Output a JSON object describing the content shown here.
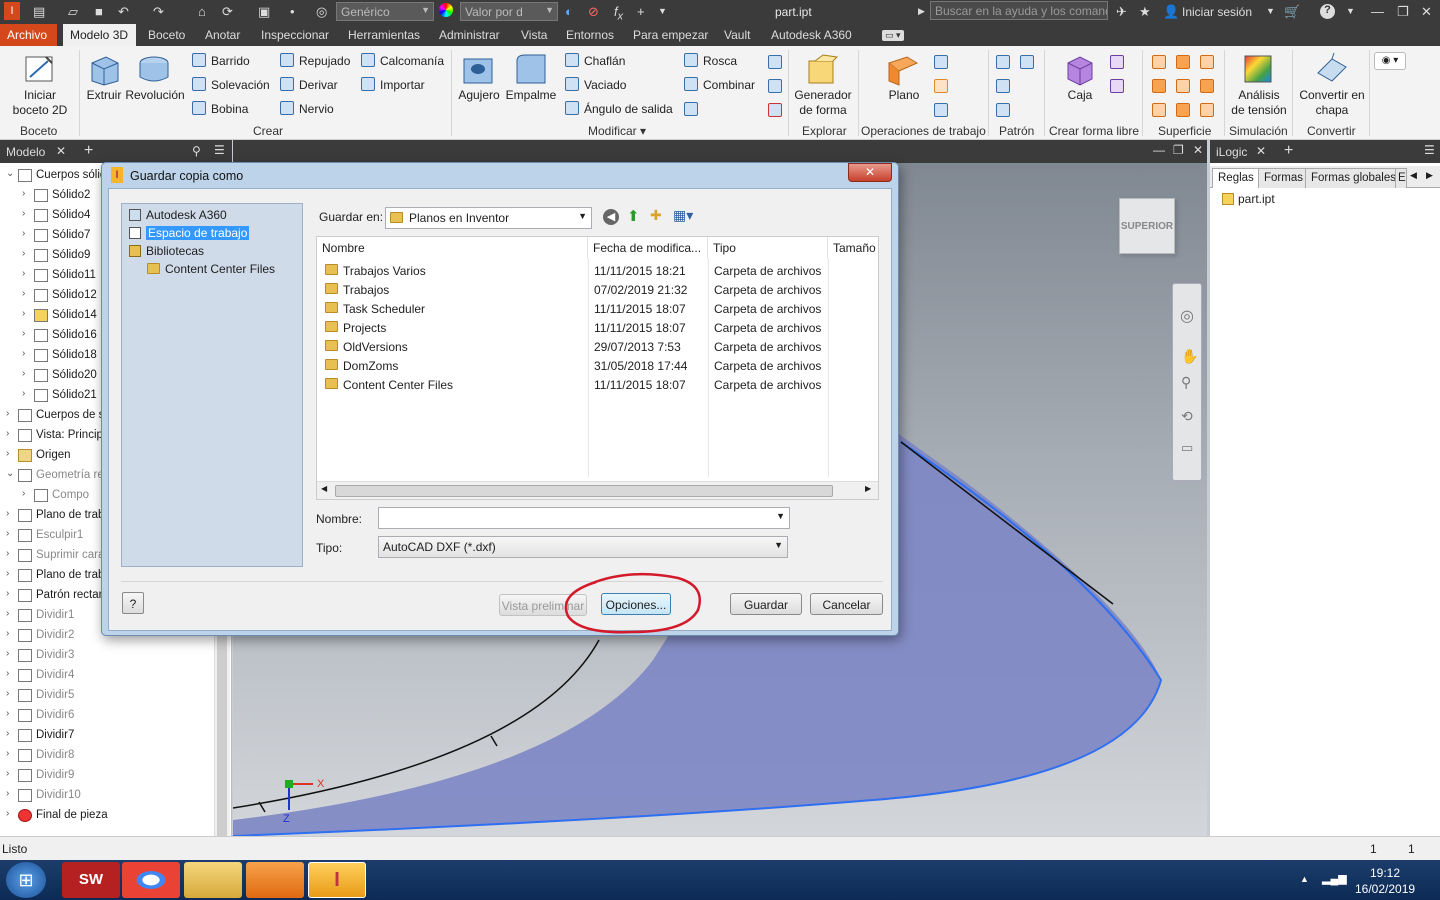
{
  "app": {
    "quick_access": {
      "material_combo": "Genérico",
      "appearance_combo": "Valor por d",
      "file_name": "part.ipt",
      "search_placeholder": "Buscar en la ayuda y los comandos",
      "signin": "Iniciar sesión"
    },
    "ribbon_tabs": [
      "Archivo",
      "Modelo 3D",
      "Boceto",
      "Anotar",
      "Inspeccionar",
      "Herramientas",
      "Administrar",
      "Vista",
      "Entornos",
      "Para empezar",
      "Vault",
      "Autodesk A360"
    ],
    "ribbon": {
      "boceto": {
        "start_sketch": "Iniciar\nboceto 2D",
        "group": "Boceto"
      },
      "crear": {
        "extruir": "Extruir",
        "revolucion": "Revolución",
        "barrido": "Barrido",
        "solevacion": "Solevación",
        "bobina": "Bobina",
        "repujado": "Repujado",
        "derivar": "Derivar",
        "nervio": "Nervio",
        "calcomania": "Calcomanía",
        "importar": "Importar",
        "group": "Crear"
      },
      "modificar": {
        "agujero": "Agujero",
        "empalme": "Empalme",
        "chaflan": "Chaflán",
        "vaciado": "Vaciado",
        "angulo": "Ángulo de salida",
        "rosca": "Rosca",
        "combinar": "Combinar",
        "group": "Modificar ▾"
      },
      "explorar": {
        "generador": "Generador\nde forma",
        "group": "Explorar"
      },
      "operaciones": {
        "plano": "Plano",
        "group": "Operaciones de trabajo"
      },
      "patron": {
        "group": "Patrón"
      },
      "forma_libre": {
        "caja": "Caja",
        "group": "Crear forma libre"
      },
      "superficie": {
        "group": "Superficie"
      },
      "simulacion": {
        "analisis": "Análisis\nde tensión",
        "group": "Simulación"
      },
      "convertir": {
        "chapa": "Convertir en\nchapa",
        "group": "Convertir"
      }
    },
    "browser": {
      "tab": "Modelo",
      "items": [
        {
          "label": "Cuerpos sólidos",
          "lvl": 0
        },
        {
          "label": "Sólido2",
          "lvl": 1
        },
        {
          "label": "Sólido4",
          "lvl": 1
        },
        {
          "label": "Sólido7",
          "lvl": 1
        },
        {
          "label": "Sólido9",
          "lvl": 1
        },
        {
          "label": "Sólido11",
          "lvl": 1
        },
        {
          "label": "Sólido12",
          "lvl": 1
        },
        {
          "label": "Sólido14",
          "lvl": 1
        },
        {
          "label": "Sólido16",
          "lvl": 1
        },
        {
          "label": "Sólido18",
          "lvl": 1
        },
        {
          "label": "Sólido20",
          "lvl": 1
        },
        {
          "label": "Sólido21",
          "lvl": 1
        },
        {
          "label": "Cuerpos de superficie",
          "lvl": 0
        },
        {
          "label": "Vista: Principal",
          "lvl": 0
        },
        {
          "label": "Origen",
          "lvl": 0
        },
        {
          "label": "Geometría re",
          "lvl": 0,
          "dim": true
        },
        {
          "label": "Compo",
          "lvl": 1,
          "dim": true
        },
        {
          "label": "Plano de trabajo",
          "lvl": 0
        },
        {
          "label": "Esculpir1",
          "lvl": 0,
          "dim": true
        },
        {
          "label": "Suprimir cara",
          "lvl": 0,
          "dim": true
        },
        {
          "label": "Plano de trabajo",
          "lvl": 0
        },
        {
          "label": "Patrón rectangular",
          "lvl": 0
        },
        {
          "label": "Dividir1",
          "lvl": 0,
          "dim": true
        },
        {
          "label": "Dividir2",
          "lvl": 0,
          "dim": true
        },
        {
          "label": "Dividir3",
          "lvl": 0,
          "dim": true
        },
        {
          "label": "Dividir4",
          "lvl": 0,
          "dim": true
        },
        {
          "label": "Dividir5",
          "lvl": 0,
          "dim": true
        },
        {
          "label": "Dividir6",
          "lvl": 0,
          "dim": true
        },
        {
          "label": "Dividir7",
          "lvl": 0
        },
        {
          "label": "Dividir8",
          "lvl": 0,
          "dim": true
        },
        {
          "label": "Dividir9",
          "lvl": 0,
          "dim": true
        },
        {
          "label": "Dividir10",
          "lvl": 0,
          "dim": true
        },
        {
          "label": "Final de pieza",
          "lvl": 0
        }
      ]
    },
    "viewcube_label": "SUPERIOR",
    "ilogic": {
      "tab": "iLogic",
      "tabs": [
        "Reglas",
        "Formas",
        "Formas globales",
        "E"
      ],
      "item": "part.ipt"
    },
    "status": {
      "text": "Listo",
      "count1": "1",
      "count2": "1"
    },
    "taskbar": {
      "time": "19:12",
      "date": "16/02/2019"
    }
  },
  "dialog": {
    "title": "Guardar copia como",
    "places": [
      "Autodesk A360",
      "Espacio de trabajo",
      "Bibliotecas",
      "Content Center Files"
    ],
    "save_in_label": "Guardar en:",
    "save_in_value": "Planos en Inventor",
    "columns": [
      "Nombre",
      "Fecha de modifica...",
      "Tipo",
      "Tamaño"
    ],
    "files": [
      {
        "name": "Trabajos Varios",
        "date": "11/11/2015 18:21",
        "type": "Carpeta de archivos"
      },
      {
        "name": "Trabajos",
        "date": "07/02/2019 21:32",
        "type": "Carpeta de archivos"
      },
      {
        "name": "Task Scheduler",
        "date": "11/11/2015 18:07",
        "type": "Carpeta de archivos"
      },
      {
        "name": "Projects",
        "date": "11/11/2015 18:07",
        "type": "Carpeta de archivos"
      },
      {
        "name": "OldVersions",
        "date": "29/07/2013 7:53",
        "type": "Carpeta de archivos"
      },
      {
        "name": "DomZoms",
        "date": "31/05/2018 17:44",
        "type": "Carpeta de archivos"
      },
      {
        "name": "Content Center Files",
        "date": "11/11/2015 18:07",
        "type": "Carpeta de archivos"
      }
    ],
    "name_label": "Nombre:",
    "name_value": "",
    "type_label": "Tipo:",
    "type_value": "AutoCAD DXF (*.dxf)",
    "buttons": {
      "help": "?",
      "preview": "Vista preliminar",
      "options": "Opciones...",
      "save": "Guardar",
      "cancel": "Cancelar"
    }
  },
  "colors": {
    "accent": "#d4481c",
    "annotation_circle": "#d21a2a",
    "part_fill": "#7d86c4",
    "selection": "#3399ff"
  }
}
